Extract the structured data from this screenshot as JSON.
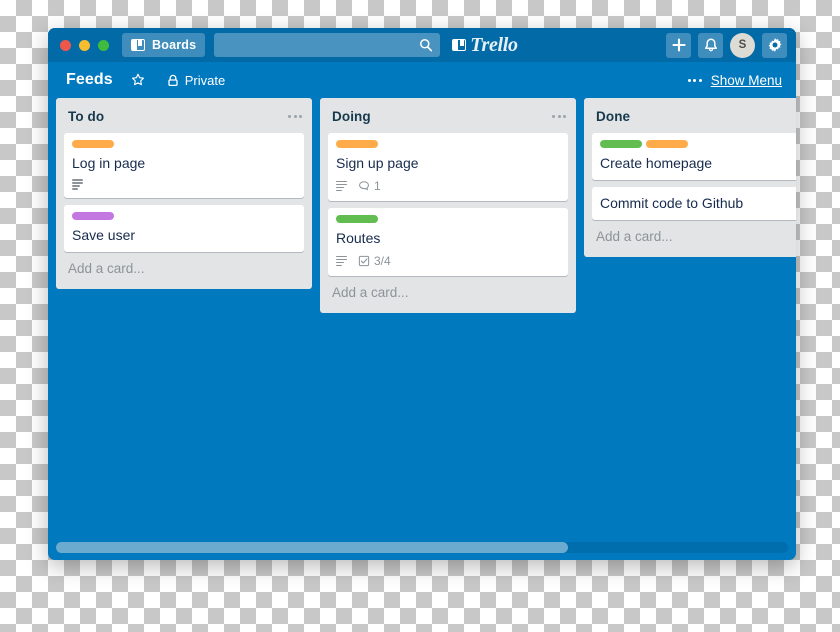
{
  "window": {
    "traffic_lights": [
      "close",
      "minimize",
      "zoom"
    ],
    "colors": {
      "topbar": "#026aa7",
      "board_background": "#0079bf",
      "list_background": "#e2e4e6",
      "card_background": "#ffffff"
    }
  },
  "topbar": {
    "boards_button": "Boards",
    "search": {
      "value": "",
      "placeholder": ""
    },
    "logo_text": "Trello",
    "add_button": "+",
    "notifications_icon": "bell-icon",
    "avatar_initials": "S",
    "settings_icon": "gear-icon"
  },
  "board_header": {
    "title": "Feeds",
    "star_icon": "star-icon",
    "privacy_icon": "lock-icon",
    "privacy_label": "Private",
    "menu_dots": "ellipsis-icon",
    "show_menu_label": "Show Menu"
  },
  "lists": [
    {
      "title": "To do",
      "add_card_label": "Add a card...",
      "cards": [
        {
          "title": "Log in page",
          "labels": [
            "#ffab4a"
          ],
          "badges": {
            "description": true,
            "comments": null,
            "checklist": null
          }
        },
        {
          "title": "Save user",
          "labels": [
            "#c377e0"
          ],
          "badges": {
            "description": false,
            "comments": null,
            "checklist": null
          }
        }
      ]
    },
    {
      "title": "Doing",
      "add_card_label": "Add a card...",
      "cards": [
        {
          "title": "Sign up page",
          "labels": [
            "#ffab4a"
          ],
          "badges": {
            "description": true,
            "comments": "1",
            "checklist": null
          }
        },
        {
          "title": "Routes",
          "labels": [
            "#61bd4f"
          ],
          "badges": {
            "description": true,
            "comments": null,
            "checklist": "3/4"
          }
        }
      ]
    },
    {
      "title": "Done",
      "add_card_label": "Add a card...",
      "cards": [
        {
          "title": "Create homepage",
          "labels": [
            "#61bd4f",
            "#ffab4a"
          ],
          "badges": {
            "description": false,
            "comments": null,
            "checklist": null
          }
        },
        {
          "title": "Commit code to Github",
          "labels": [],
          "badges": {
            "description": false,
            "comments": null,
            "checklist": null
          }
        }
      ]
    }
  ],
  "scrollbar": {
    "thumb_percent": 70
  }
}
